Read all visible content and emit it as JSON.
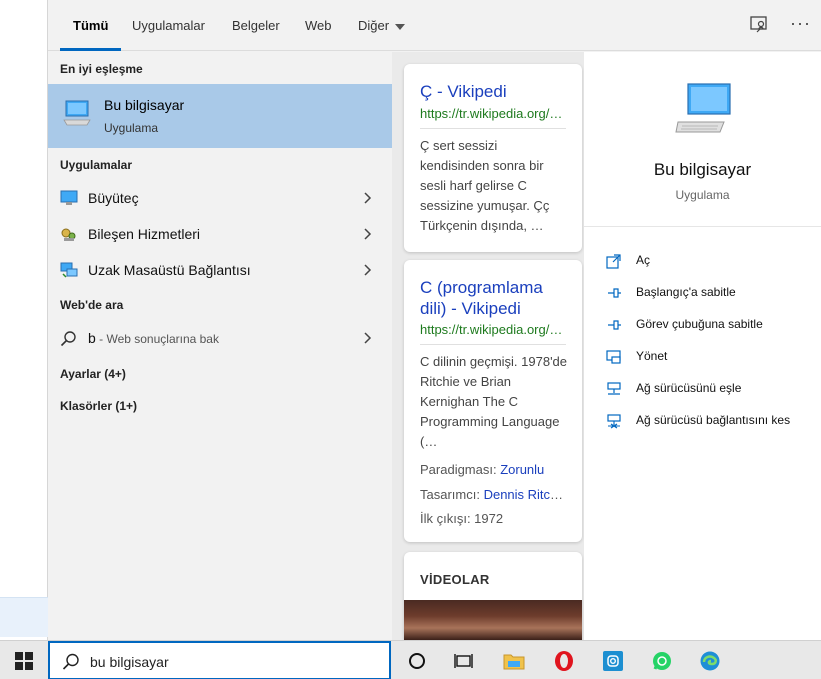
{
  "tabs": [
    {
      "label": "Tümü"
    },
    {
      "label": "Uygulamalar"
    },
    {
      "label": "Belgeler"
    },
    {
      "label": "Web"
    },
    {
      "label": "Diğer"
    }
  ],
  "toolbar": {
    "feedback_icon": "feedback-icon",
    "more_icon": "more-icon",
    "more_label": "···"
  },
  "left": {
    "best_match_heading": "En iyi eşleşme",
    "best_match": {
      "title": "Bu bilgisayar",
      "subtitle": "Uygulama"
    },
    "apps_heading": "Uygulamalar",
    "apps": [
      {
        "label": "Büyüteç",
        "icon": "magnifier-icon"
      },
      {
        "label": "Bileşen Hizmetleri",
        "icon": "component-services-icon"
      },
      {
        "label": "Uzak Masaüstü Bağlantısı",
        "icon": "remote-desktop-icon"
      }
    ],
    "web_heading": "Web'de ara",
    "web_query": "b",
    "web_suffix": " - Web sonuçlarına bak",
    "settings": "Ayarlar (4+)",
    "folders": "Klasörler (1+)"
  },
  "cards": [
    {
      "title": "Ç - Vikipedi",
      "url": "https://tr.wikipedia.org/wiki/Ç",
      "desc": "Ç sert sessizi kendisinden sonra bir sesli harf gelirse C sessizine yumuşar. Çç Türkçenin dışında, …"
    },
    {
      "title": "C (programlama dili) - Vikipedi",
      "url": "https://tr.wikipedia.org/wiki/C",
      "desc": "C dilinin geçmişi. 1978'de Ritchie ve Brian Kernighan The C Programming Language (…",
      "facts": [
        {
          "key": "Paradigması: ",
          "value": "Zorunlu"
        },
        {
          "key": "Tasarımcı: ",
          "value": "Dennis Ritchie"
        },
        {
          "key": "İlk çıkışı: ",
          "value": "1972"
        }
      ]
    },
    {
      "heading": "VİDEOLAR"
    }
  ],
  "detail": {
    "title": "Bu bilgisayar",
    "subtitle": "Uygulama",
    "actions": [
      {
        "label": "Aç",
        "icon": "open-icon"
      },
      {
        "label": "Başlangıç'a sabitle",
        "icon": "pin-start-icon"
      },
      {
        "label": "Görev çubuğuna sabitle",
        "icon": "pin-taskbar-icon"
      },
      {
        "label": "Yönet",
        "icon": "manage-icon"
      },
      {
        "label": "Ağ sürücüsünü eşle",
        "icon": "map-drive-icon"
      },
      {
        "label": "Ağ sürücüsü bağlantısını kes",
        "icon": "disconnect-drive-icon"
      }
    ]
  },
  "taskbar": {
    "search_value": "bu bilgisayar",
    "apps": [
      "cortana-icon",
      "task-view-icon",
      "file-explorer-icon",
      "opera-icon",
      "instagram-icon",
      "whatsapp-icon",
      "edge-icon"
    ]
  },
  "colors": {
    "accent": "#0067c0",
    "selected": "#a9c9e8",
    "link": "#1a3fbd",
    "url": "#1e7a1e"
  }
}
